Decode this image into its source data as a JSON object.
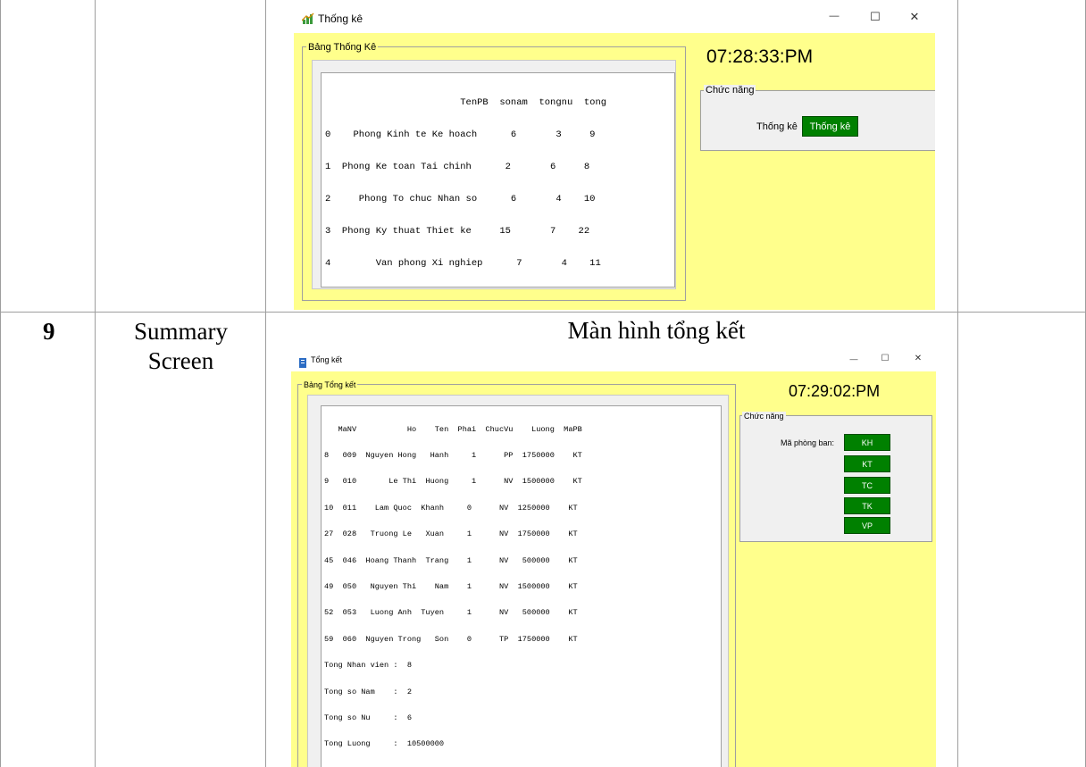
{
  "row9": {
    "number": "9",
    "description_line1": "Summary",
    "description_line2": "Screen",
    "caption": "Màn hình tổng kết"
  },
  "win_statistics": {
    "title": "Thống kê",
    "group_title": "Bảng Thống Kê",
    "clock": "07:28:33:PM",
    "func_group_title": "Chức năng",
    "action_label": "Thống kê",
    "action_button": "Thống kê",
    "table_lines": [
      "                        TenPB  sonam  tongnu  tong",
      "0    Phong Kinh te Ke hoach      6       3     9",
      "1  Phong Ke toan Tai chinh      2       6     8",
      "2     Phong To chuc Nhan so      6       4    10",
      "3  Phong Ky thuat Thiet ke     15       7    22",
      "4        Van phong Xi nghiep      7       4    11"
    ]
  },
  "win_summary": {
    "title": "Tổng kết",
    "group_title": "Bảng Tổng kết",
    "clock": "07:29:02:PM",
    "func_group_title": "Chức năng",
    "dept_label": "Mã phòng ban:",
    "dept_buttons": [
      "KH",
      "KT",
      "TC",
      "TK",
      "VP"
    ],
    "table_lines": [
      "   MaNV           Ho    Ten  Phai  ChucVu    Luong  MaPB",
      "8   009  Nguyen Hong   Hanh     1      PP  1750000    KT",
      "9   010       Le Thi  Huong     1      NV  1500000    KT",
      "10  011    Lam Quoc  Khanh     0      NV  1250000    KT",
      "27  028   Truong Le   Xuan     1      NV  1750000    KT",
      "45  046  Hoang Thanh  Trang    1      NV   500000    KT",
      "49  050   Nguyen Thi    Nam    1      NV  1500000    KT",
      "52  053   Luong Anh  Tuyen     1      NV   500000    KT",
      "59  060  Nguyen Trong   Son    0      TP  1750000    KT",
      "Tong Nhan vien :  8",
      "Tong so Nam    :  2",
      "Tong so Nu     :  6",
      "Tong Luong     :  10500000"
    ]
  },
  "window_controls": {
    "minimize": "—",
    "maximize": "☐",
    "close": "✕"
  }
}
